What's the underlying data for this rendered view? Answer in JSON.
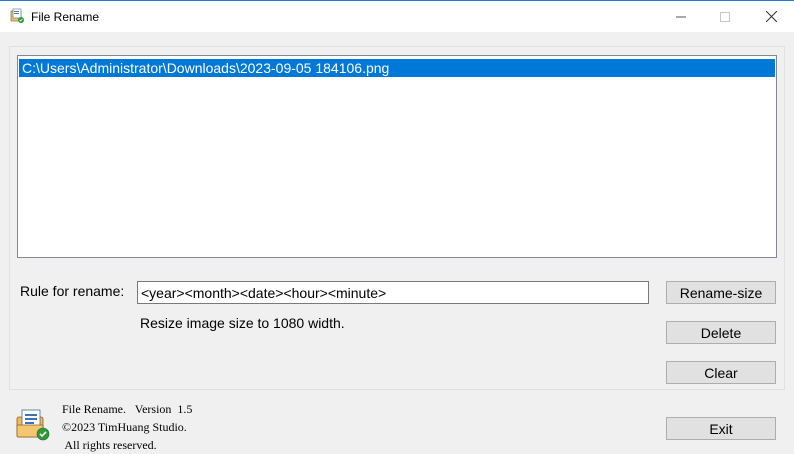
{
  "window": {
    "title": "File Rename",
    "app_icon": "file-rename-app-icon"
  },
  "window_controls": {
    "minimize_icon": "minimize-icon",
    "maximize_icon": "maximize-icon",
    "close_icon": "close-icon"
  },
  "file_list": {
    "items": [
      {
        "path": "C:\\Users\\Administrator\\Downloads\\2023-09-05 184106.png",
        "selected": true
      }
    ]
  },
  "rule": {
    "label": "Rule for rename:",
    "value": "<year><month><date><hour><minute>"
  },
  "resize_note": "Resize image size to 1080 width.",
  "buttons": {
    "rename_size": "Rename-size",
    "delete": "Delete",
    "clear": "Clear",
    "exit": "Exit"
  },
  "about": {
    "line1": "File Rename.   Version  1.5",
    "line2": "©2023 TimHuang Studio.",
    "line3": " All rights reserved."
  },
  "colors": {
    "selection": "#0078d7",
    "window_bg": "#f0f0f0",
    "button_bg": "#e1e1e1",
    "title_border": "#2b78d4"
  }
}
